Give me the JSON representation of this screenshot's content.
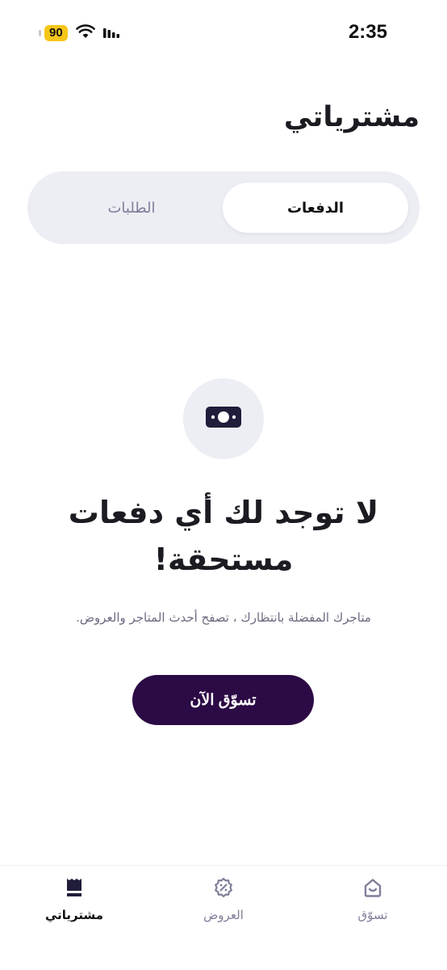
{
  "status_bar": {
    "time": "2:35",
    "battery": "90"
  },
  "header": {
    "title": "مشترياتي"
  },
  "tabs": [
    {
      "label": "الدفعات",
      "active": true
    },
    {
      "label": "الطلبات",
      "active": false
    }
  ],
  "empty_state": {
    "icon": "money-icon",
    "title_line1": "لا توجد لك أي دفعات",
    "title_line2": "مستحقة!",
    "description": "متاجرك المفضلة بانتظارك ، تصفح أحدث المتاجر والعروض.",
    "button_label": "تسوّق الآن"
  },
  "bottom_nav": {
    "items": [
      {
        "label": "تسوّق",
        "icon": "shop-home-icon",
        "active": false
      },
      {
        "label": "العروض",
        "icon": "discount-icon",
        "active": false
      },
      {
        "label": "مشترياتي",
        "icon": "purchases-icon",
        "active": true
      }
    ]
  },
  "colors": {
    "primary": "#2c0a45",
    "muted": "#7f7e99",
    "surface": "#eceef4",
    "battery": "#f5c518"
  }
}
